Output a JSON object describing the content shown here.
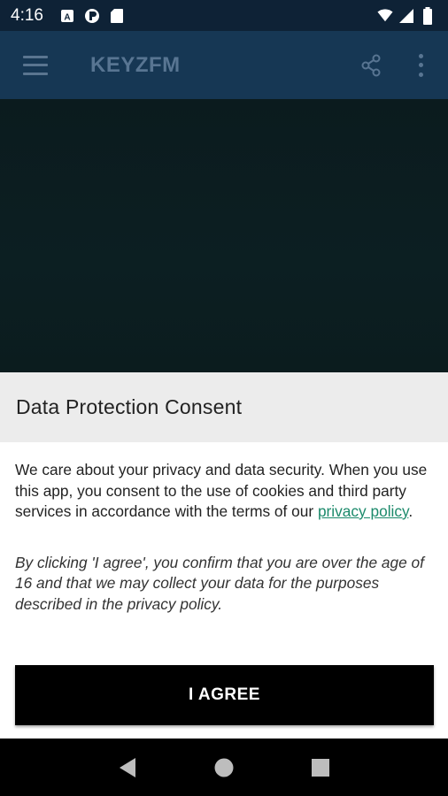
{
  "status_bar": {
    "time": "4:16",
    "left_icons": [
      "a-box-icon",
      "circle-p-icon",
      "sd-card-icon"
    ],
    "right_icons": [
      "wifi-icon",
      "signal-icon",
      "battery-icon"
    ]
  },
  "app_bar": {
    "title": "KEYZFM",
    "actions": [
      "share-icon",
      "more-vert-icon"
    ]
  },
  "dialog": {
    "title": "Data Protection Consent",
    "body_before_link": "We care about your privacy and data security. When you use this app, you consent to the use of cookies and third party services in accordance with the terms of our ",
    "link_text": "privacy policy",
    "body_after_link": ".",
    "note": "By clicking 'I agree', you confirm that you are over the age of 16 and that we may collect your data for the purposes described in the privacy policy.",
    "agree_label": "I AGREE"
  },
  "nav_bar": {
    "buttons": [
      "back-icon",
      "home-icon",
      "recents-icon"
    ]
  },
  "colors": {
    "status_bar": "#0e2236",
    "app_bar": "#163754",
    "link": "#1c8a6b",
    "button": "#000000"
  }
}
